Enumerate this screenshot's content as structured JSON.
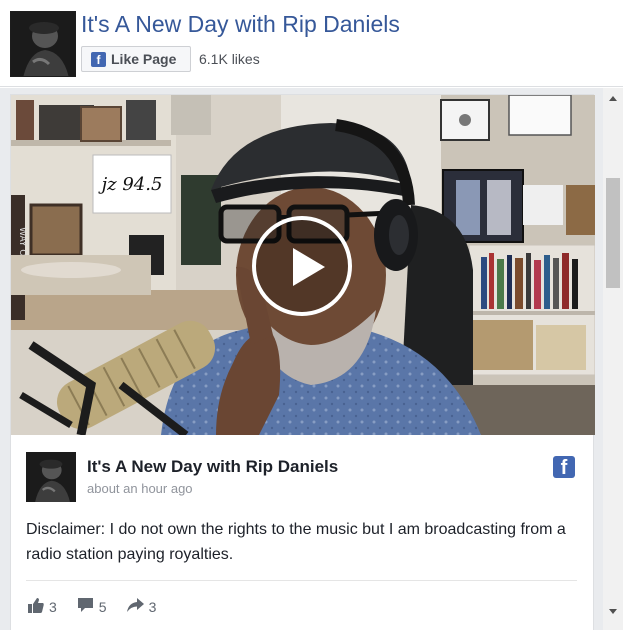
{
  "header": {
    "title": "It's A New Day with Rip Daniels",
    "like_button_label": "Like Page",
    "likes": "6.1K likes"
  },
  "video": {
    "station_sign": "jz 94.5",
    "poster_text": "WAY OF LIFE"
  },
  "post": {
    "author": "It's A New Day with Rip Daniels",
    "time": "about an hour ago",
    "text": "Disclaimer: I do not own the rights to the music but I am broadcasting from a radio station paying royalties.",
    "likes_count": "3",
    "comments_count": "5",
    "shares_count": "3"
  },
  "icons": {
    "facebook": "facebook-icon",
    "play": "play-icon",
    "like": "thumbs-up-icon",
    "comment": "comment-icon",
    "share": "share-icon"
  },
  "colors": {
    "brand": "#4267b2",
    "link": "#365899"
  }
}
